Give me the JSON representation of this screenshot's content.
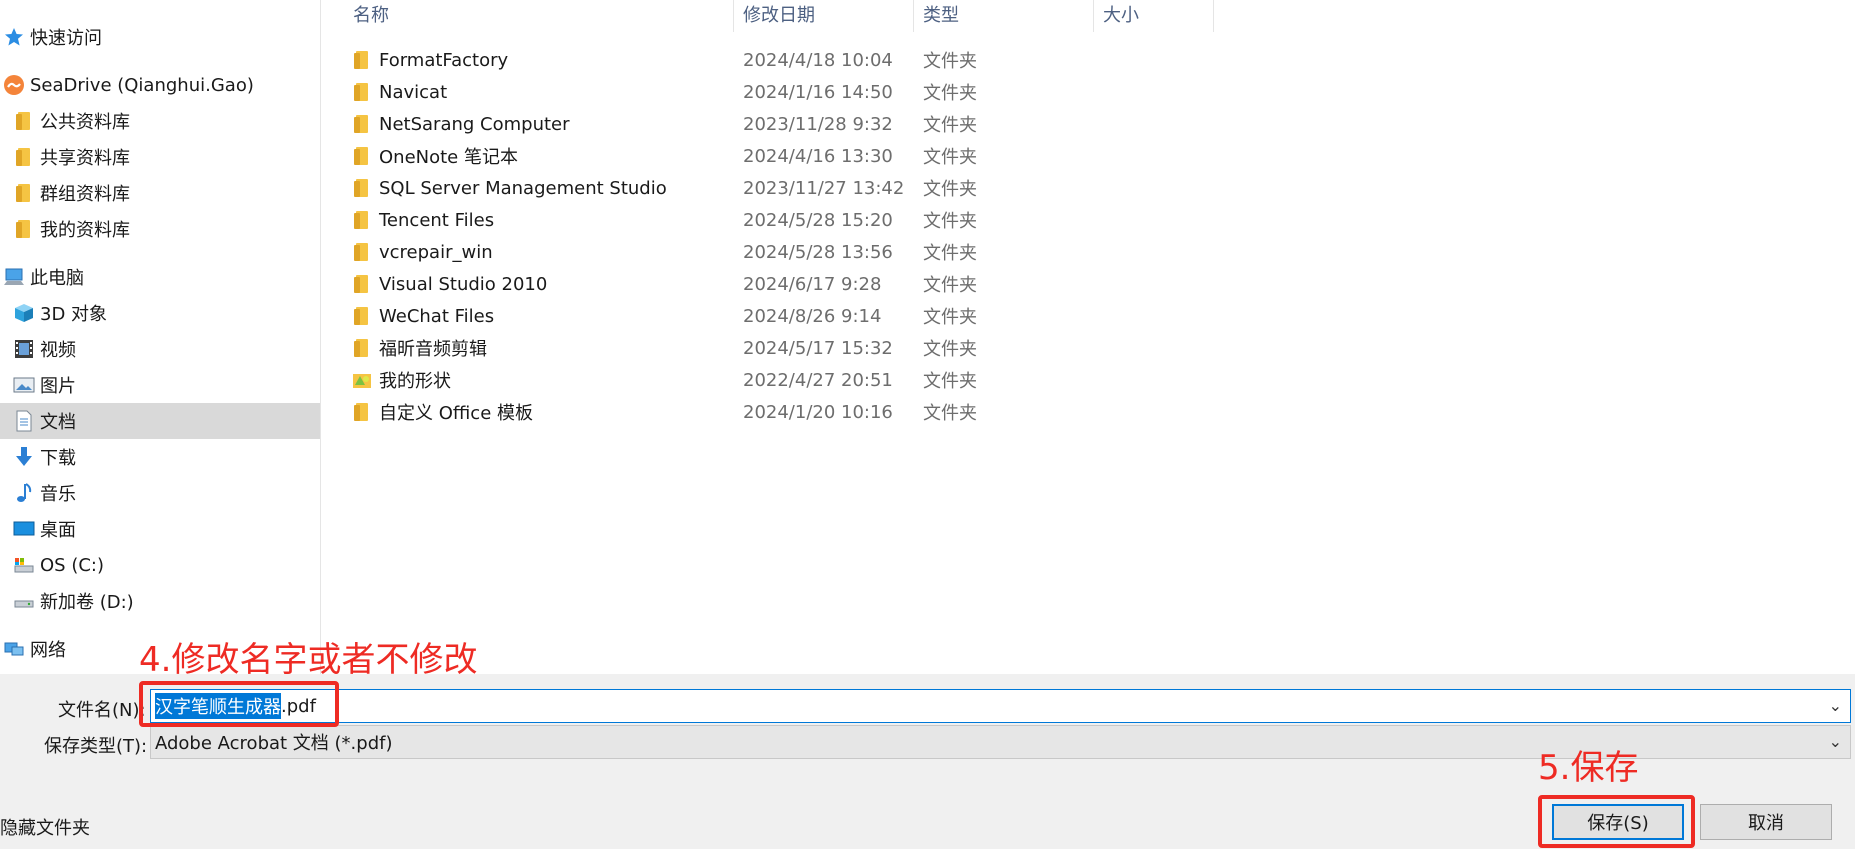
{
  "nav": {
    "quick_access": "快速访问",
    "seadrive": "SeaDrive (Qianghui.Gao)",
    "sea_items": [
      "公共资料库",
      "共享资料库",
      "群组资料库",
      "我的资料库"
    ],
    "this_pc": "此电脑",
    "pc_items": [
      "3D 对象",
      "视频",
      "图片",
      "文档",
      "下载",
      "音乐",
      "桌面",
      "OS (C:)",
      "新加卷 (D:)"
    ],
    "network": "网络",
    "selected": "文档"
  },
  "list": {
    "columns": [
      "名称",
      "修改日期",
      "类型",
      "大小"
    ],
    "rows": [
      {
        "name": "FormatFactory",
        "date": "2024/4/18 10:04",
        "type": "文件夹",
        "icon": "folder-icon"
      },
      {
        "name": "Navicat",
        "date": "2024/1/16 14:50",
        "type": "文件夹",
        "icon": "folder-icon"
      },
      {
        "name": "NetSarang Computer",
        "date": "2023/11/28 9:32",
        "type": "文件夹",
        "icon": "folder-icon"
      },
      {
        "name": "OneNote 笔记本",
        "date": "2024/4/16 13:30",
        "type": "文件夹",
        "icon": "folder-icon"
      },
      {
        "name": "SQL Server Management Studio",
        "date": "2023/11/27 13:42",
        "type": "文件夹",
        "icon": "folder-icon"
      },
      {
        "name": "Tencent Files",
        "date": "2024/5/28 15:20",
        "type": "文件夹",
        "icon": "folder-icon"
      },
      {
        "name": "vcrepair_win",
        "date": "2024/5/28 13:56",
        "type": "文件夹",
        "icon": "folder-icon"
      },
      {
        "name": "Visual Studio 2010",
        "date": "2024/6/17 9:28",
        "type": "文件夹",
        "icon": "folder-icon"
      },
      {
        "name": "WeChat Files",
        "date": "2024/8/26 9:14",
        "type": "文件夹",
        "icon": "folder-icon"
      },
      {
        "name": "福昕音频剪辑",
        "date": "2024/5/17 15:32",
        "type": "文件夹",
        "icon": "folder-icon"
      },
      {
        "name": "我的形状",
        "date": "2022/4/27 20:51",
        "type": "文件夹",
        "icon": "shapes-folder-icon"
      },
      {
        "name": "自定义 Office 模板",
        "date": "2024/1/20 10:16",
        "type": "文件夹",
        "icon": "folder-icon"
      }
    ]
  },
  "form": {
    "filename_label": "文件名(N):",
    "filename_selected": "汉字笔顺生成器",
    "filename_rest": ".pdf",
    "filetype_label": "保存类型(T):",
    "filetype_value": "Adobe Acrobat 文档 (*.pdf)",
    "hide_folders": "隐藏文件夹",
    "save": "保存(S)",
    "cancel": "取消"
  },
  "annotations": {
    "step4": "4.修改名字或者不修改",
    "step5": "5.保存",
    "color": "#ee2b24"
  },
  "colors": {
    "accent": "#0078d7",
    "selected_nav": "#d9d9d9",
    "header_text": "#4d6082"
  }
}
